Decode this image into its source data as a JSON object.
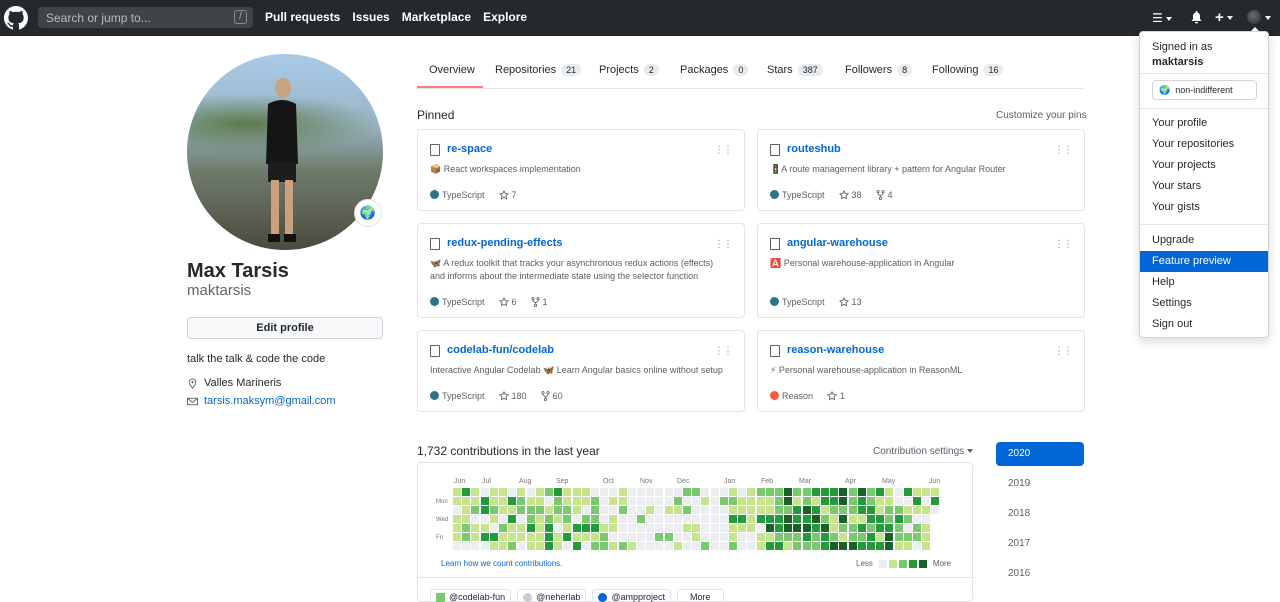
{
  "header": {
    "search_placeholder": "Search or jump to...",
    "search_shortcut": "/",
    "nav": [
      "Pull requests",
      "Issues",
      "Marketplace",
      "Explore"
    ]
  },
  "profile": {
    "full_name": "Max Tarsis",
    "username": "maktarsis",
    "edit_label": "Edit profile",
    "bio": "talk the talk & code the code",
    "location": "Valles Marineris",
    "email": "tarsis.maksym@gmail.com"
  },
  "tabs": [
    {
      "label": "Overview",
      "count": ""
    },
    {
      "label": "Repositories",
      "count": "21"
    },
    {
      "label": "Projects",
      "count": "2"
    },
    {
      "label": "Packages",
      "count": "0"
    },
    {
      "label": "Stars",
      "count": "387"
    },
    {
      "label": "Followers",
      "count": "8"
    },
    {
      "label": "Following",
      "count": "16"
    }
  ],
  "pinned": {
    "title": "Pinned",
    "customize": "Customize your pins",
    "cards": [
      {
        "owner": "",
        "name": "re-space",
        "desc": "📦 React workspaces implementation",
        "lang": "TypeScript",
        "lang_color": "#2b7489",
        "stars": "7",
        "forks": ""
      },
      {
        "owner": "",
        "name": "routeshub",
        "desc": "🚦A route management library + pattern for Angular Router",
        "lang": "TypeScript",
        "lang_color": "#2b7489",
        "stars": "38",
        "forks": "4"
      },
      {
        "owner": "",
        "name": "redux-pending-effects",
        "desc": "🦋 A redux toolkit that tracks your asynchronous redux actions (effects) and informs about the intermediate state using the selector function",
        "lang": "TypeScript",
        "lang_color": "#2b7489",
        "stars": "6",
        "forks": "1"
      },
      {
        "owner": "",
        "name": "angular-warehouse",
        "desc": "🅰️ Personal warehouse-application in Angular",
        "lang": "TypeScript",
        "lang_color": "#2b7489",
        "stars": "13",
        "forks": ""
      },
      {
        "owner": "codelab-fun/",
        "name": "codelab",
        "desc": "Interactive Angular Codelab 🦋 Learn Angular basics online without setup",
        "lang": "TypeScript",
        "lang_color": "#2b7489",
        "stars": "180",
        "forks": "60"
      },
      {
        "owner": "",
        "name": "reason-warehouse",
        "desc": "⚡ Personal warehouse-application in ReasonML",
        "lang": "Reason",
        "lang_color": "#ff5847",
        "stars": "1",
        "forks": ""
      }
    ]
  },
  "contributions": {
    "title": "1,732 contributions in the last year",
    "settings": "Contribution settings",
    "months": [
      "Jun",
      "Jul",
      "Aug",
      "Sep",
      "Oct",
      "Nov",
      "Dec",
      "Jan",
      "Feb",
      "Mar",
      "Apr",
      "May",
      "Jun"
    ],
    "days": [
      "Mon",
      "Wed",
      "Fri"
    ],
    "learn": "Learn how we count contributions.",
    "less": "Less",
    "more": "More",
    "level_colors": [
      "#ebedf0",
      "#c6e48b",
      "#7bc96f",
      "#239a3b",
      "#196127"
    ],
    "orgs": [
      "@codelab-fun",
      "@neherlab",
      "@ampproject",
      "More"
    ],
    "years": [
      "2020",
      "2019",
      "2018",
      "2017",
      "2016"
    ]
  },
  "dropdown": {
    "signed_in_as": "Signed in as",
    "user": "maktarsis",
    "status": "non-indifferent",
    "group1": [
      "Your profile",
      "Your repositories",
      "Your projects",
      "Your stars",
      "Your gists"
    ],
    "group2": [
      "Upgrade",
      "Feature preview",
      "Help",
      "Settings",
      "Sign out"
    ]
  }
}
